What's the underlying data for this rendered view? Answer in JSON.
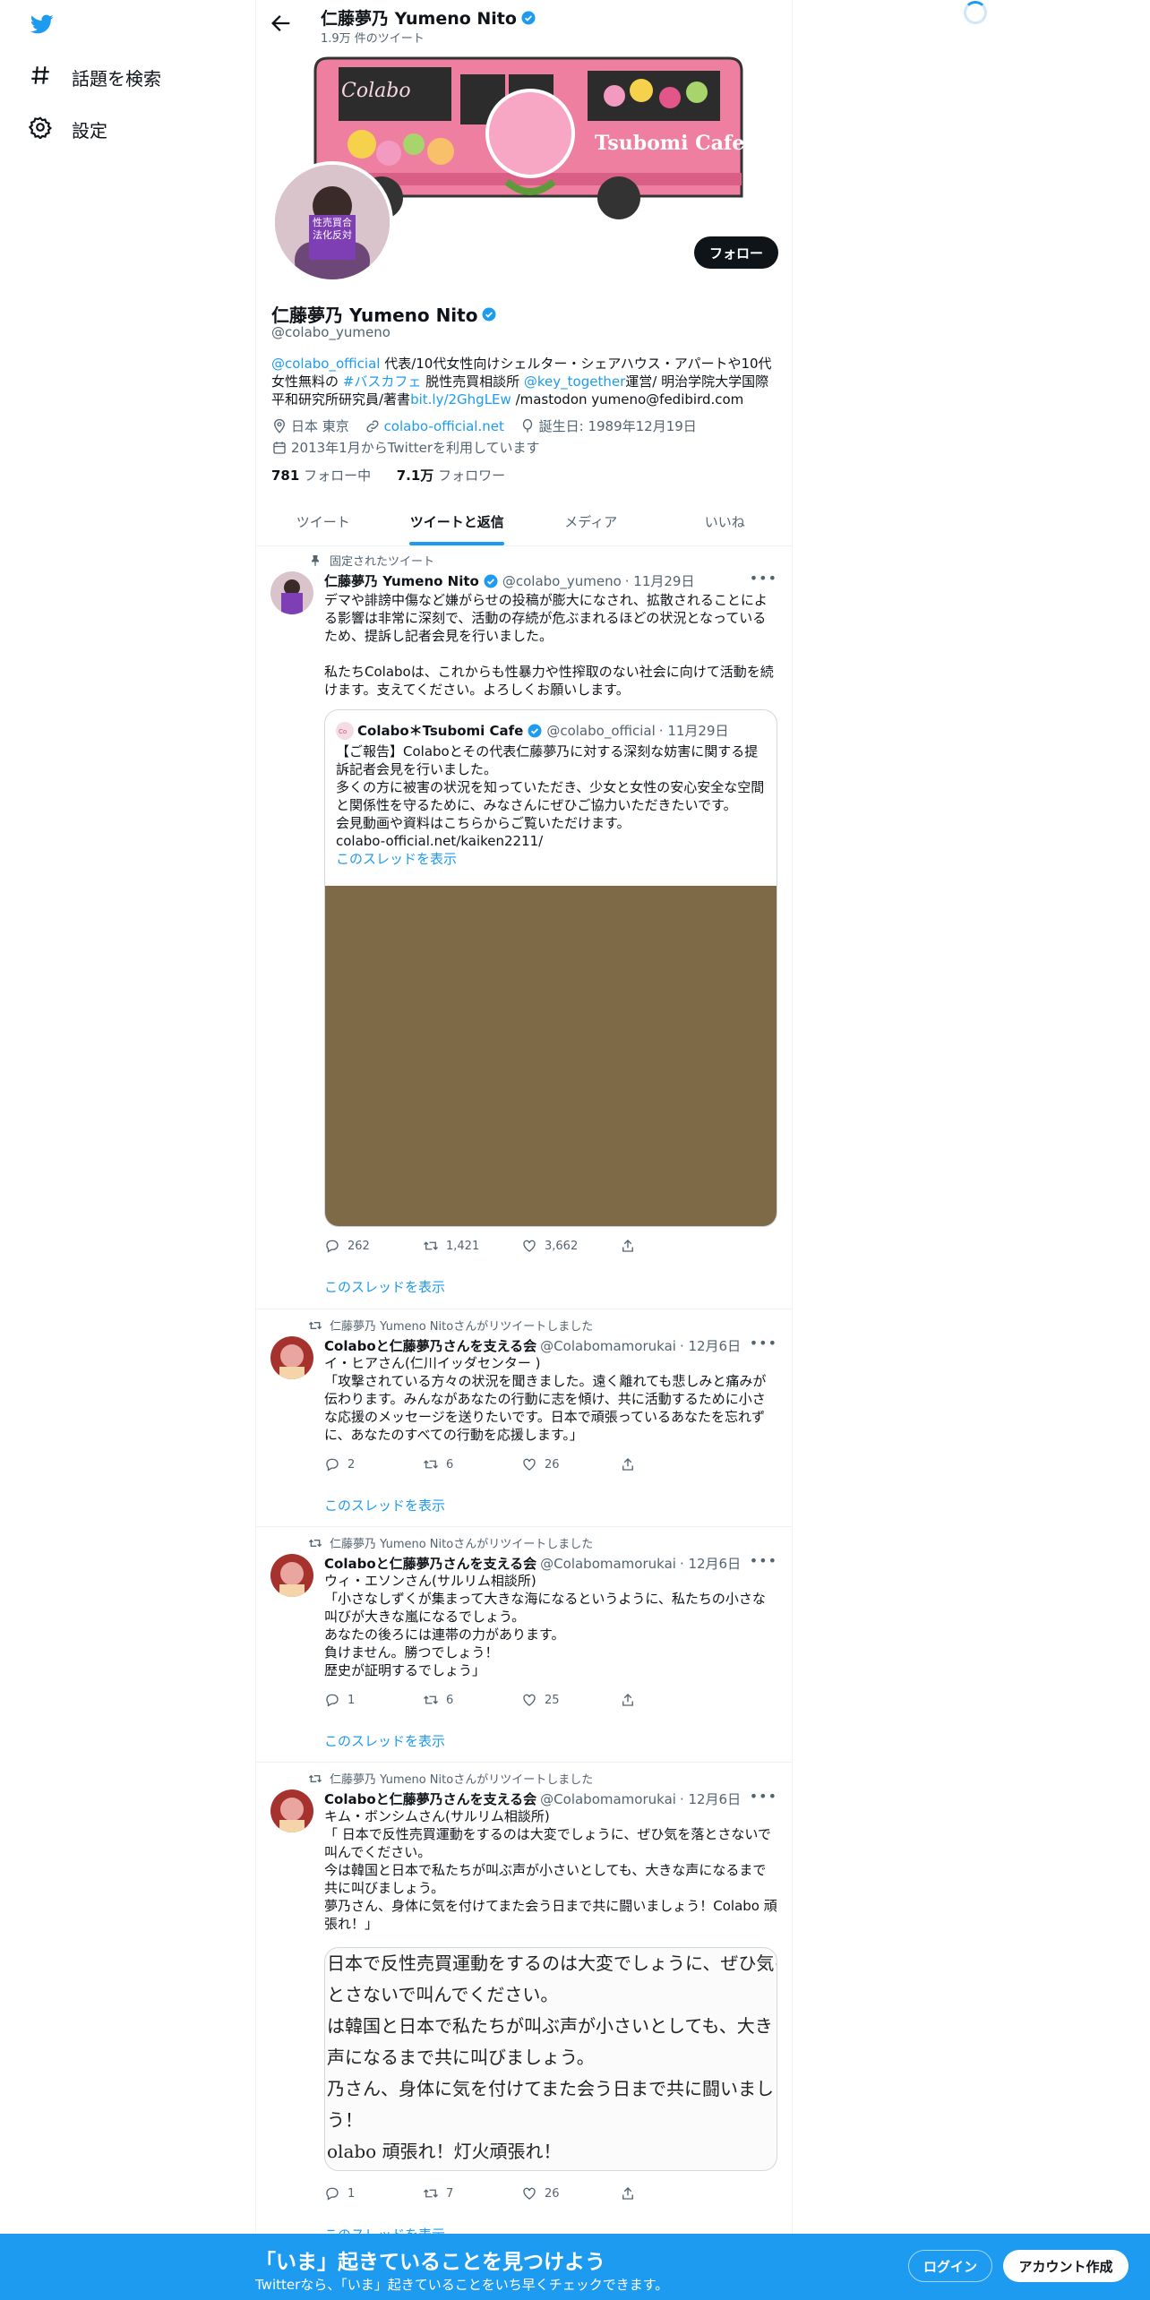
{
  "nav": {
    "explore_label": "話題を検索",
    "settings_label": "設定"
  },
  "header": {
    "name": "仁藤夢乃 Yumeno Nito",
    "tweet_count": "1.9万 件のツイート"
  },
  "banner": {
    "bus_logo": "Colabo",
    "bus_sign": "Tsubomi Cafe"
  },
  "avatar": {
    "sign_text": "性売買合法化反対"
  },
  "profile": {
    "follow_label": "フォロー",
    "name": "仁藤夢乃  Yumeno Nito",
    "handle": "@colabo_yumeno",
    "bio": {
      "link1": "@colabo_official",
      "t1": " 代表/10代女性向けシェルター・シェアハウス・アパートや10代女性無料の ",
      "link2": "#バスカフェ",
      "t2": " 脱性売買相談所 ",
      "link3": "@key_together",
      "t3": "運営/ 明治学院大学国際平和研究所研究員/著書",
      "link4": "bit.ly/2GhgLEw",
      "t4": " /mastodon yumeno@fedibird.com"
    },
    "location": "日本 東京",
    "website": "colabo-official.net",
    "birthday": "誕生日: 1989年12月19日",
    "joined": "2013年1月からTwitterを利用しています",
    "following_count": "781",
    "following_label": "フォロー中",
    "followers_count": "7.1万",
    "followers_label": "フォロワー"
  },
  "tabs": [
    {
      "label": "ツイート"
    },
    {
      "label": "ツイートと返信"
    },
    {
      "label": "メディア"
    },
    {
      "label": "いいね"
    }
  ],
  "tweets": [
    {
      "social": "固定されたツイート",
      "name": "仁藤夢乃 Yumeno Nito",
      "handle": "@colabo_yumeno",
      "date": "· 11月29日",
      "text": "デマや誹謗中傷など嫌がらせの投稿が膨大になされ、拡散されることによる影響は非常に深刻で、活動の存続が危ぶまれるほどの状況となっているため、提訴し記者会見を行いました。\n\n私たちColaboは、これからも性暴力や性搾取のない社会に向けて活動を続けます。支えてください。よろしくお願いします。",
      "quote": {
        "name": "Colabo＊Tsubomi Cafe",
        "handle": "@colabo_official",
        "date": "· 11月29日",
        "text": "【ご報告】Colaboとその代表仁藤夢乃に対する深刻な妨害に関する提訴記者会見を行いました。\n多くの方に被害の状況を知っていただき、少女と女性の安心安全な空間と関係性を守るために、みなさんにぜひご協力いただきたいです。\n会見動画や資料はこちらからご覧いただけます。\ncolabo-official.net/kaiken2211/",
        "show_thread": "このスレッドを表示"
      },
      "replies": "262",
      "retweets": "1,421",
      "likes": "3,662",
      "show_thread": "このスレッドを表示"
    },
    {
      "social": "仁藤夢乃 Yumeno Nitoさんがリツイートしました",
      "name": "Colaboと仁藤夢乃さんを支える会",
      "handle": "@Colabomamorukai",
      "date": "· 12月6日",
      "text": "イ・ヒアさん(仁川イッダセンター )\n「攻撃されている方々の状況を聞きました。遠く離れても悲しみと痛みが伝わります。みんながあなたの行動に志を傾け、共に活動するために小さな応援のメッセージを送りたいです。日本で頑張っているあなたを忘れずに、あなたのすべての行動を応援します。」",
      "replies": "2",
      "retweets": "6",
      "likes": "26",
      "show_thread": "このスレッドを表示"
    },
    {
      "social": "仁藤夢乃 Yumeno Nitoさんがリツイートしました",
      "name": "Colaboと仁藤夢乃さんを支える会",
      "handle": "@Colabomamorukai",
      "date": "· 12月6日",
      "text": "ウィ・エソンさん(サルリム相談所)\n「小さなしずくが集まって大きな海になるというように、私たちの小さな叫びが大きな嵐になるでしょう。\nあなたの後ろには連帯の力があります。\n負けません。勝つでしょう！\n歴史が証明するでしょう」",
      "replies": "1",
      "retweets": "6",
      "likes": "25",
      "show_thread": "このスレッドを表示"
    },
    {
      "social": "仁藤夢乃 Yumeno Nitoさんがリツイートしました",
      "name": "Colaboと仁藤夢乃さんを支える会",
      "handle": "@Colabomamorukai",
      "date": "· 12月6日",
      "text": "キム・ボンシムさん(サルリム相談所)\n「 日本で反性売買運動をするのは大変でしょうに、ぜひ気を落とさないで叫んでください。\n今は韓国と日本で私たちが叫ぶ声が小さいとしても、大きな声になるまで共に叫びましょう。\n夢乃さん、身体に気を付けてまた会う日まで共に闘いましょう！Colabo 頑張れ！」",
      "image_lines": [
        "日本で反性売買運動をするのは大変でしょうに、ぜひ気を",
        "とさないで叫んでください。",
        "は韓国と日本で私たちが叫ぶ声が小さいとしても、大き",
        "声になるまで共に叫びましょう。",
        "乃さん、身体に気を付けてまた会う日まで共に闘いまし",
        "う！",
        "olabo 頑張れ！灯火頑張れ！"
      ],
      "replies": "1",
      "retweets": "7",
      "likes": "26",
      "show_thread": "このスレッドを表示"
    }
  ],
  "bottom_bar": {
    "title": "「いま」起きていることを見つけよう",
    "subtitle": "Twitterなら、「いま」起きていることをいち早くチェックできます。",
    "login_label": "ログイン",
    "signup_label": "アカウント作成"
  }
}
